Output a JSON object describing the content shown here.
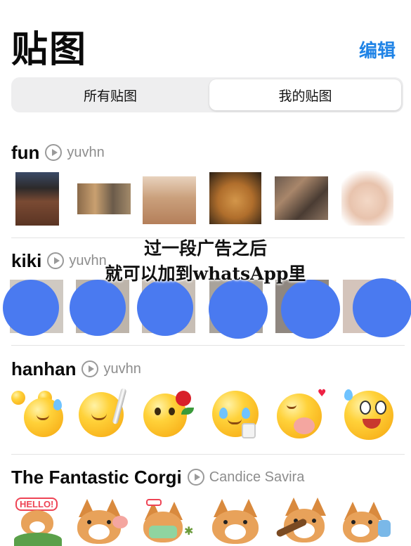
{
  "header": {
    "title": "贴图",
    "edit_label": "编辑"
  },
  "segmented": {
    "options": [
      "所有贴图",
      "我的贴图"
    ],
    "selected": "我的贴图"
  },
  "packs": [
    {
      "name": "fun",
      "author": "yuvhn",
      "sticker_count": 6
    },
    {
      "name": "kiki",
      "author": "yuvhn",
      "sticker_count": 6
    },
    {
      "name": "hanhan",
      "author": "yuvhn",
      "sticker_count": 6
    },
    {
      "name": "The Fantastic Corgi",
      "author": "Candice Savira",
      "sticker_count": 6
    }
  ],
  "overlay": {
    "line1": "过一段广告之后",
    "line2": "就可以加到whatsApp里"
  },
  "corgi_sticker_text": "HELLO!",
  "colors": {
    "accent": "#1f83e6",
    "redaction_blob": "#4a7af0",
    "secondary_text": "#8d8d8d"
  }
}
